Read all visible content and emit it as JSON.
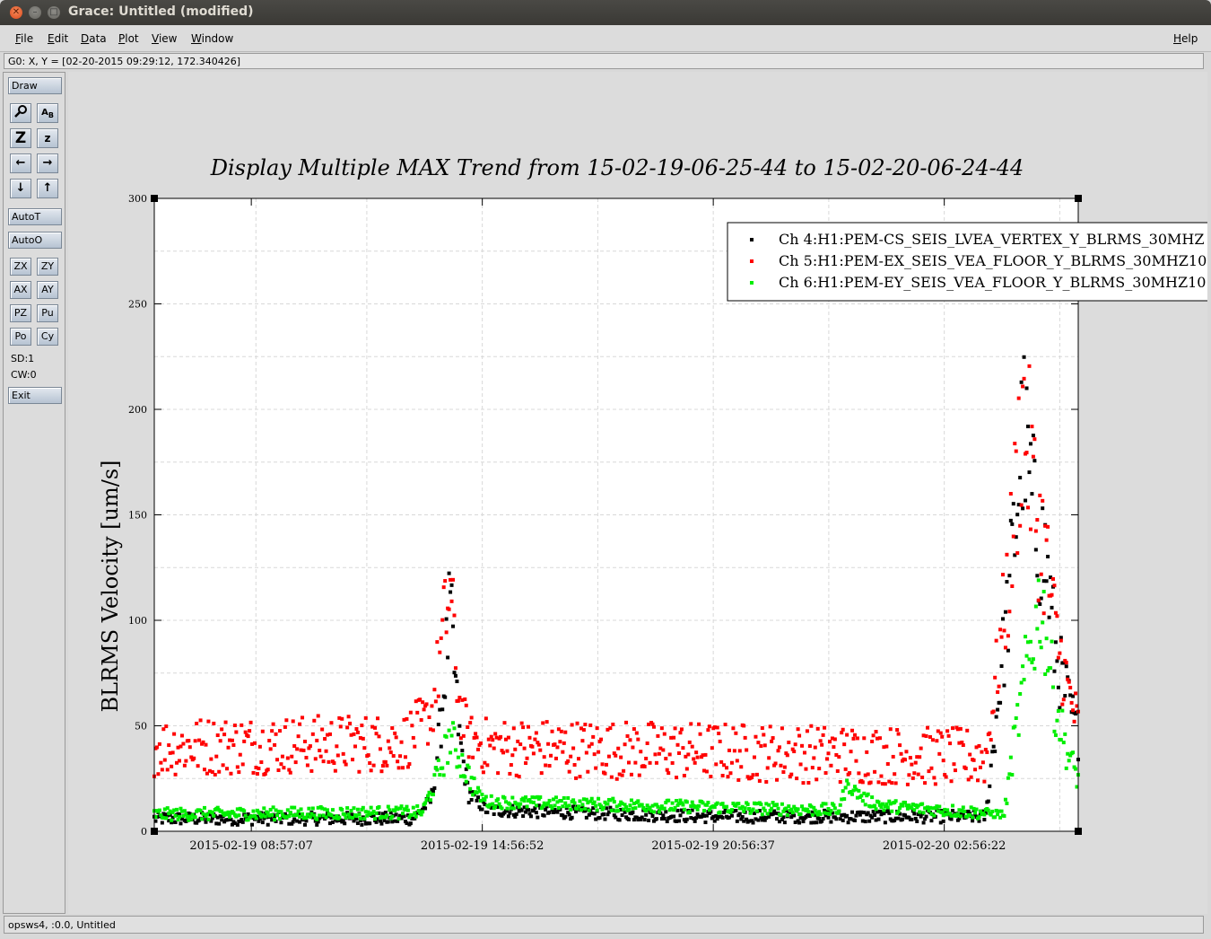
{
  "window": {
    "title": "Grace: Untitled (modified)"
  },
  "menubar": {
    "items": [
      "File",
      "Edit",
      "Data",
      "Plot",
      "View",
      "Window"
    ],
    "help": "Help"
  },
  "coord_readout": "G0: X, Y = [02-20-2015 09:29:12, 172.340426]",
  "toolbar": {
    "draw": "Draw",
    "autot": "AutoT",
    "autoo": "AutoO",
    "zoom_buttons": [
      [
        "ZX",
        "ZY"
      ],
      [
        "AX",
        "AY"
      ],
      [
        "PZ",
        "Pu"
      ],
      [
        "Po",
        "Cy"
      ]
    ],
    "sd": "SD:1",
    "cw": "CW:0",
    "exit": "Exit",
    "icons": [
      "magnifier-icon",
      "text-ab-icon",
      "zoom-in-icon",
      "zoom-out-icon",
      "arrow-left-icon",
      "arrow-right-icon",
      "arrow-down-icon",
      "arrow-up-icon"
    ]
  },
  "status": "opsws4, :0.0, Untitled",
  "chart_data": {
    "type": "scatter",
    "title": "Display Multiple MAX Trend from 15-02-19-06-25-44 to 15-02-20-06-24-44",
    "ylabel": "BLRMS Velocity [um/s]",
    "xlabel": "",
    "ylim": [
      0,
      300
    ],
    "yticks": [
      0,
      50,
      100,
      150,
      200,
      250,
      300
    ],
    "xticks": [
      "2015-02-19 08:57:07",
      "2015-02-19 14:56:52",
      "2015-02-19 20:56:37",
      "2015-02-20 02:56:22"
    ],
    "grid": true,
    "legend_position": "top-right",
    "series": [
      {
        "name": "Ch 4:H1:PEM-CS_SEIS_LVEA_VERTEX_Y_BLRMS_30MHZ",
        "color": "#000000",
        "anchors_x": [
          0.0,
          0.28,
          0.3,
          0.31,
          0.32,
          0.33,
          0.34,
          0.36,
          0.6,
          0.9,
          0.925,
          0.94,
          0.955,
          0.965,
          0.975,
          0.99,
          1.0
        ],
        "anchors_y": [
          6,
          6,
          15,
          50,
          105,
          45,
          18,
          10,
          7,
          7,
          110,
          190,
          140,
          130,
          85,
          60,
          45
        ]
      },
      {
        "name": "Ch 5:H1:PEM-EX_SEIS_VEA_FLOOR_Y_BLRMS_30MHZ10",
        "color": "#ff0000",
        "anchors_x": [
          0.0,
          0.27,
          0.3,
          0.32,
          0.33,
          0.34,
          0.36,
          0.9,
          0.925,
          0.94,
          0.955,
          0.965,
          0.975,
          0.99,
          1.0
        ],
        "anchors_y": [
          40,
          42,
          55,
          115,
          60,
          45,
          40,
          35,
          120,
          200,
          150,
          130,
          95,
          65,
          50
        ]
      },
      {
        "name": "Ch 6:H1:PEM-EY_SEIS_VEA_FLOOR_Y_BLRMS_30MHZ10",
        "color": "#00ee00",
        "anchors_x": [
          0.0,
          0.29,
          0.31,
          0.32,
          0.33,
          0.35,
          0.36,
          0.74,
          0.75,
          0.77,
          0.79,
          0.92,
          0.93,
          0.945,
          0.96,
          0.975,
          0.99,
          1.0
        ],
        "anchors_y": [
          8,
          9,
          30,
          45,
          35,
          18,
          14,
          10,
          22,
          15,
          12,
          8,
          40,
          80,
          110,
          60,
          35,
          25
        ]
      }
    ]
  }
}
